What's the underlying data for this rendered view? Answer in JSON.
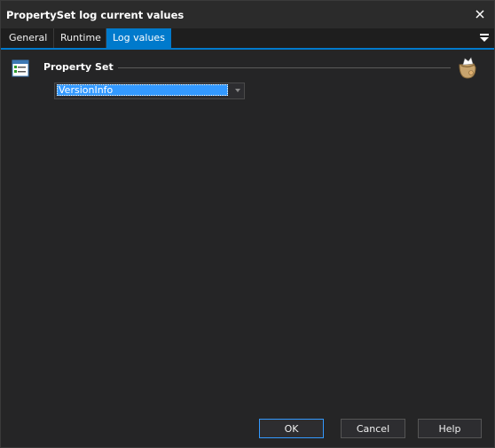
{
  "window": {
    "title": "PropertySet log current values",
    "close_icon": "close-icon"
  },
  "tabs": [
    {
      "label": "General",
      "active": false
    },
    {
      "label": "Runtime",
      "active": false
    },
    {
      "label": "Log values",
      "active": true
    }
  ],
  "tab_menu_icon": "hamburger-menu-icon",
  "section": {
    "title": "Property Set",
    "icon": "property-list-icon",
    "bag_icon": "bag-icon"
  },
  "property_set_combo": {
    "value": "VersionInfo",
    "arrow_icon": "chevron-down-icon"
  },
  "buttons": {
    "ok": "OK",
    "cancel": "Cancel",
    "help": "Help"
  },
  "colors": {
    "accent": "#007acc",
    "selection": "#3399ff",
    "background": "#252526"
  }
}
